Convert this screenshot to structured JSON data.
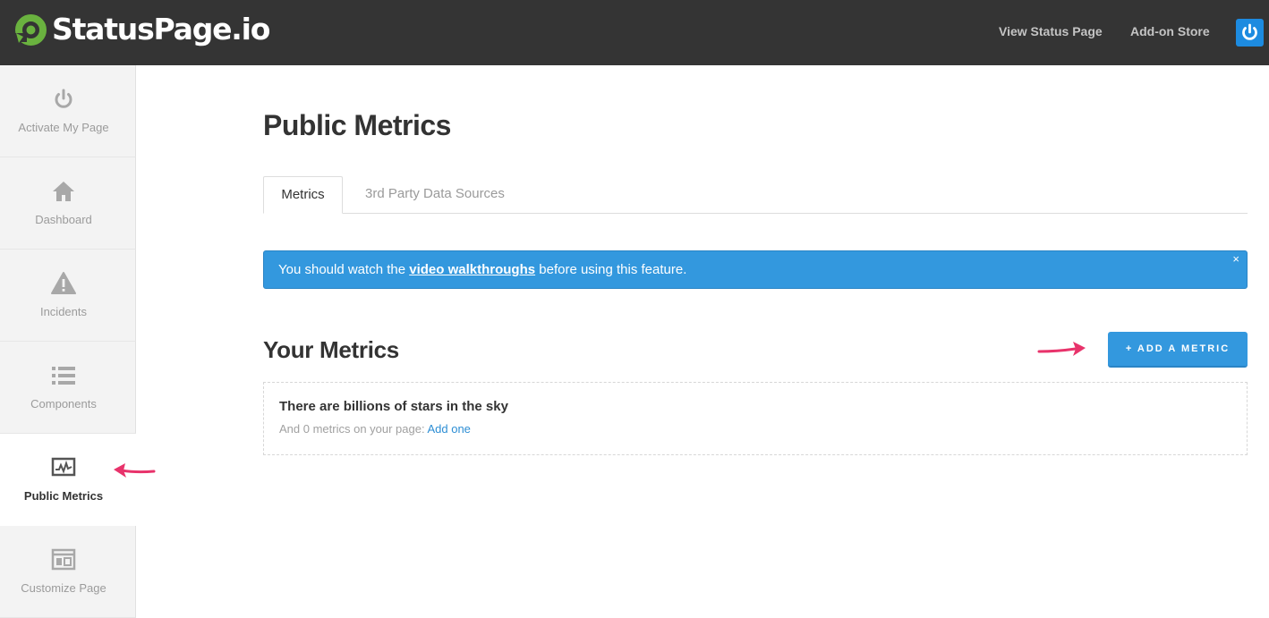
{
  "brand": {
    "name": "StatusPage.io",
    "accent": "#6ab23f"
  },
  "topnav": {
    "view_status_page": "View Status Page",
    "addon_store": "Add-on Store"
  },
  "sidebar": {
    "items": [
      {
        "label": "Activate My Page",
        "icon": "power-icon"
      },
      {
        "label": "Dashboard",
        "icon": "home-icon"
      },
      {
        "label": "Incidents",
        "icon": "warning-icon"
      },
      {
        "label": "Components",
        "icon": "list-icon"
      },
      {
        "label": "Public Metrics",
        "icon": "metrics-icon",
        "active": true
      },
      {
        "label": "Customize Page",
        "icon": "layout-icon"
      }
    ]
  },
  "main": {
    "title": "Public Metrics",
    "tabs": [
      {
        "label": "Metrics",
        "active": true
      },
      {
        "label": "3rd Party Data Sources",
        "active": false
      }
    ],
    "alert": {
      "text_before": "You should watch the ",
      "link_text": "video walkthroughs",
      "text_after": " before using this feature.",
      "close": "×"
    },
    "metrics": {
      "title": "Your Metrics",
      "add_button": "+ ADD A METRIC",
      "empty_title": "There are billions of stars in the sky",
      "empty_text": "And 0 metrics on your page: ",
      "empty_link": "Add one"
    }
  },
  "colors": {
    "topbar": "#343434",
    "primary": "#3398de",
    "annotation_arrow": "#e8336b"
  }
}
